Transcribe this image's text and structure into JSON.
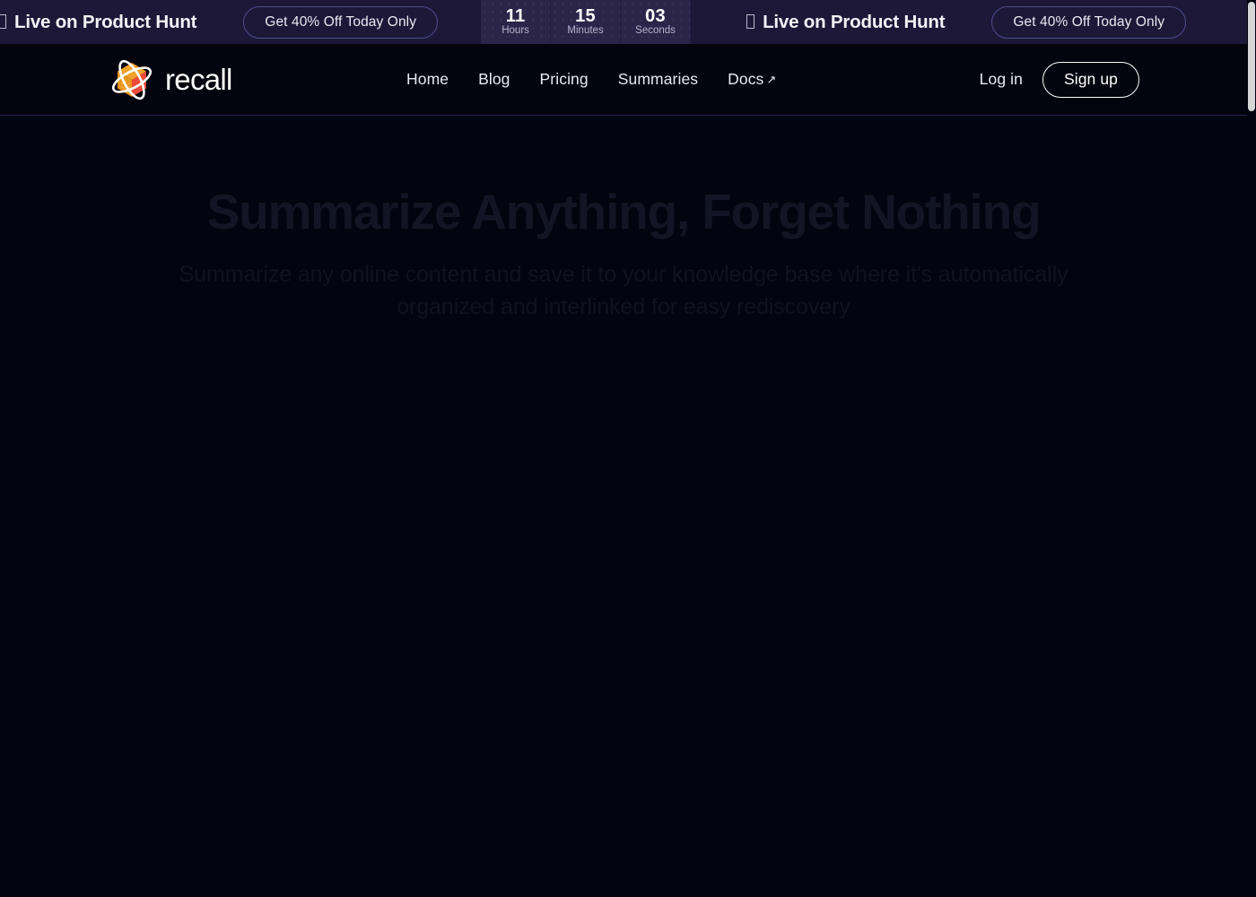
{
  "banner": {
    "messages": [
      {
        "icon": "missing-glyph-box",
        "text": "Live on Product Hunt",
        "cta": "Get 40% Off Today Only"
      },
      {
        "icon": "missing-glyph-box",
        "text": "Live on Product Hunt",
        "cta": "Get 40% Off Today Only"
      }
    ],
    "countdown": [
      {
        "value": "11",
        "label": "Hours"
      },
      {
        "value": "15",
        "label": "Minutes"
      },
      {
        "value": "03",
        "label": "Seconds"
      }
    ],
    "background_color": "#1d1838",
    "cta_border_color": "#4e4c8d"
  },
  "header": {
    "brand": {
      "name": "recall",
      "logo_icon": "recall-orbit-cube-logo"
    },
    "nav": [
      {
        "label": "Home",
        "external": false
      },
      {
        "label": "Blog",
        "external": false
      },
      {
        "label": "Pricing",
        "external": false
      },
      {
        "label": "Summaries",
        "external": false
      },
      {
        "label": "Docs",
        "external": true,
        "external_glyph": "↗"
      }
    ],
    "login_label": "Log in",
    "signup_label": "Sign up",
    "background_color": "#04040e",
    "border_color": "#2a2150"
  },
  "hero": {
    "title": "Summarize Anything, Forget Nothing",
    "subtitle": "Summarize any online content and save it to your knowledge base where it's automatically organized and interlinked for easy rediscovery",
    "title_color": "#121524",
    "subtitle_color": "#10131f"
  },
  "page": {
    "background_color": "#02040f"
  }
}
